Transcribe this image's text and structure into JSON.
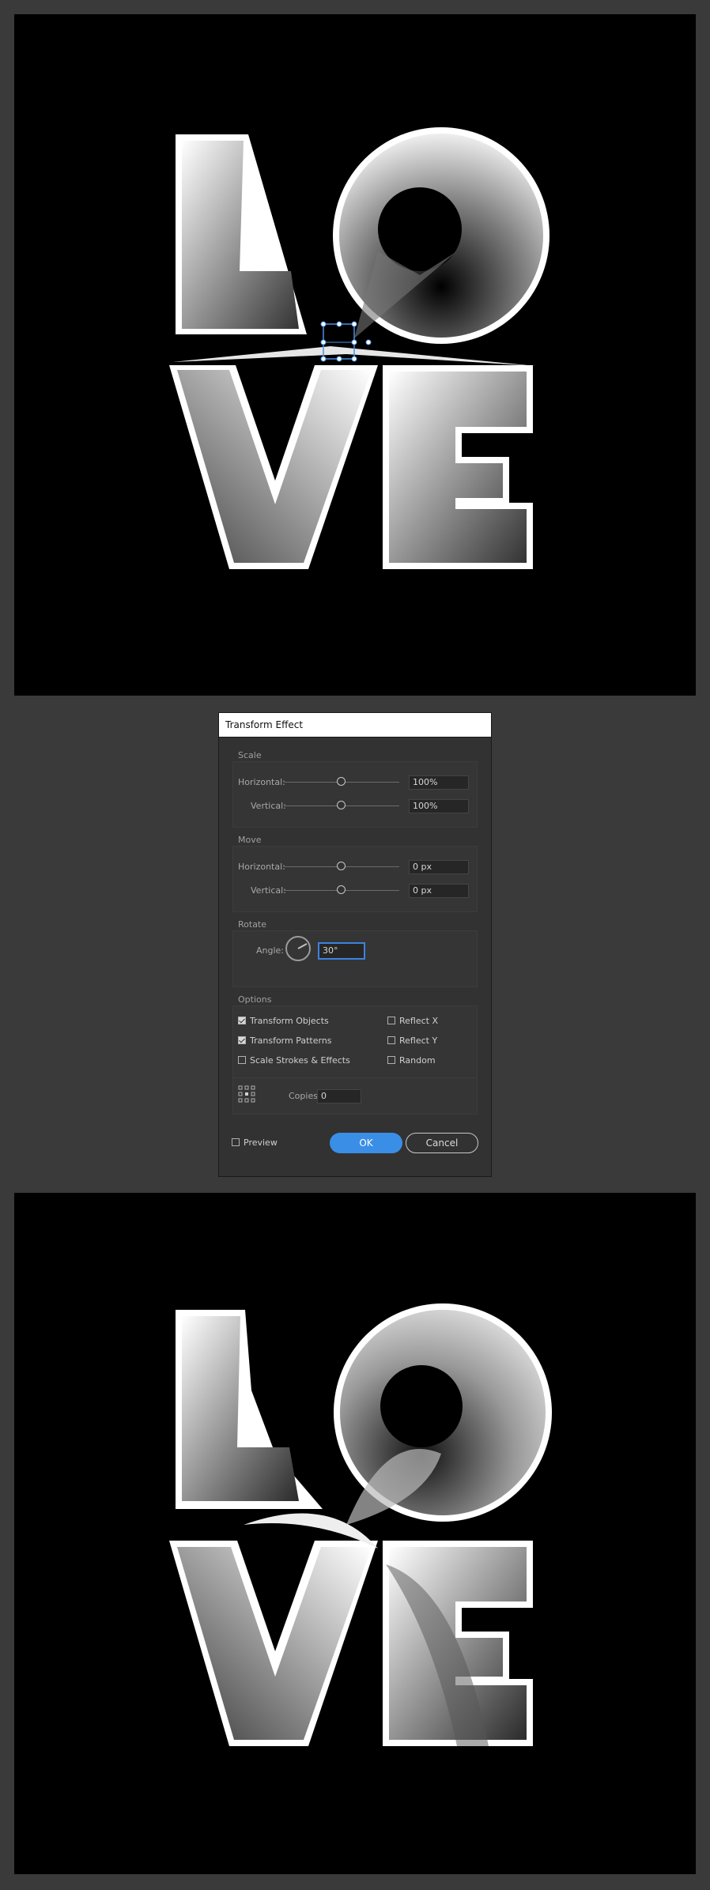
{
  "dialog": {
    "title": "Transform Effect",
    "scale": {
      "title": "Scale",
      "horizontal_label": "Horizontal:",
      "horizontal_value": "100%",
      "vertical_label": "Vertical:",
      "vertical_value": "100%"
    },
    "move": {
      "title": "Move",
      "horizontal_label": "Horizontal:",
      "horizontal_value": "0 px",
      "vertical_label": "Vertical:",
      "vertical_value": "0 px"
    },
    "rotate": {
      "title": "Rotate",
      "angle_label": "Angle:",
      "angle_value": "30°"
    },
    "options": {
      "title": "Options",
      "transform_objects": {
        "label": "Transform Objects",
        "checked": true
      },
      "transform_patterns": {
        "label": "Transform Patterns",
        "checked": true
      },
      "scale_strokes": {
        "label": "Scale Strokes & Effects",
        "checked": false
      },
      "reflect_x": {
        "label": "Reflect X",
        "checked": false
      },
      "reflect_y": {
        "label": "Reflect Y",
        "checked": false
      },
      "random": {
        "label": "Random",
        "checked": false
      },
      "copies_label": "Copies",
      "copies_value": "0"
    },
    "preview": {
      "label": "Preview",
      "checked": false
    },
    "ok_label": "OK",
    "cancel_label": "Cancel"
  },
  "artwork": {
    "letters": [
      "L",
      "O",
      "V",
      "E"
    ]
  },
  "colors": {
    "accent": "#3a8ee6",
    "background": "#3a3a3a",
    "canvas": "#000000"
  }
}
